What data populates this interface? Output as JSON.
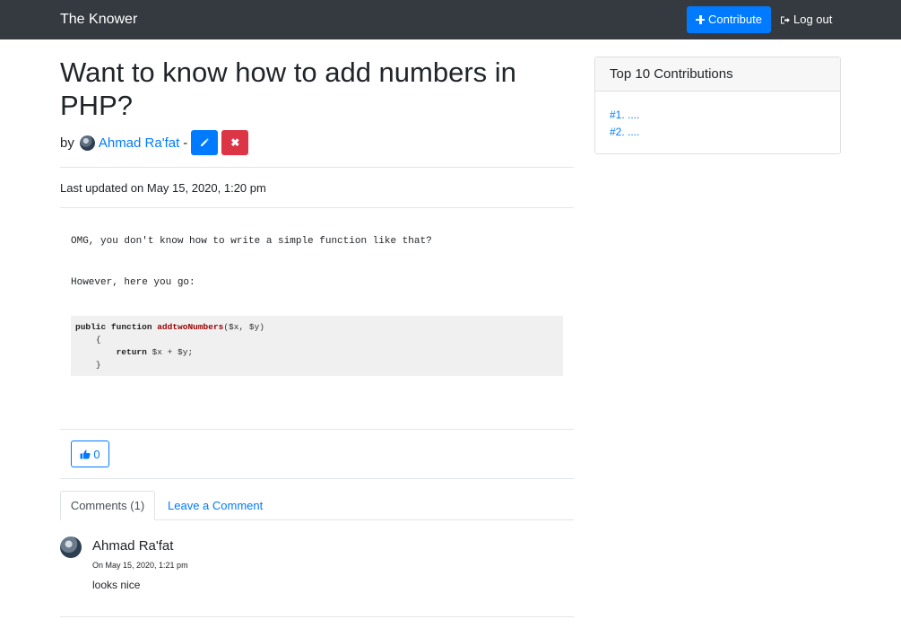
{
  "navbar": {
    "brand": "The Knower",
    "contribute_label": "Contribute",
    "logout_label": "Log out"
  },
  "post": {
    "title": "Want to know how to add numbers in PHP?",
    "by_label": "by",
    "author": "Ahmad Ra'fat",
    "separator": "-",
    "delete_symbol": "✖",
    "last_updated": "Last updated on May 15, 2020, 1:20 pm",
    "paragraph1": "OMG, you don't know how to write a simple function like that?",
    "paragraph2": "However, here you go:",
    "code": {
      "kw_public": "public",
      "kw_function": "function",
      "fn_name": "addtwoNumbers",
      "params": "($x, $y)",
      "open_brace": "{",
      "kw_return": "return",
      "return_expr": "$x + $y;",
      "close_brace": "}"
    },
    "likes": "0"
  },
  "tabs": {
    "comments": "Comments (1)",
    "leave_comment": "Leave a Comment"
  },
  "comments": [
    {
      "author": "Ahmad Ra'fat",
      "date": "On May 15, 2020, 1:21 pm",
      "text": "looks nice"
    }
  ],
  "sidebar": {
    "title": "Top 10 Contributions",
    "items": [
      "#1. ....",
      "#2. ...."
    ]
  },
  "colors": {
    "primary": "#007bff",
    "danger": "#dc3545",
    "navbar_bg": "#343a40"
  }
}
